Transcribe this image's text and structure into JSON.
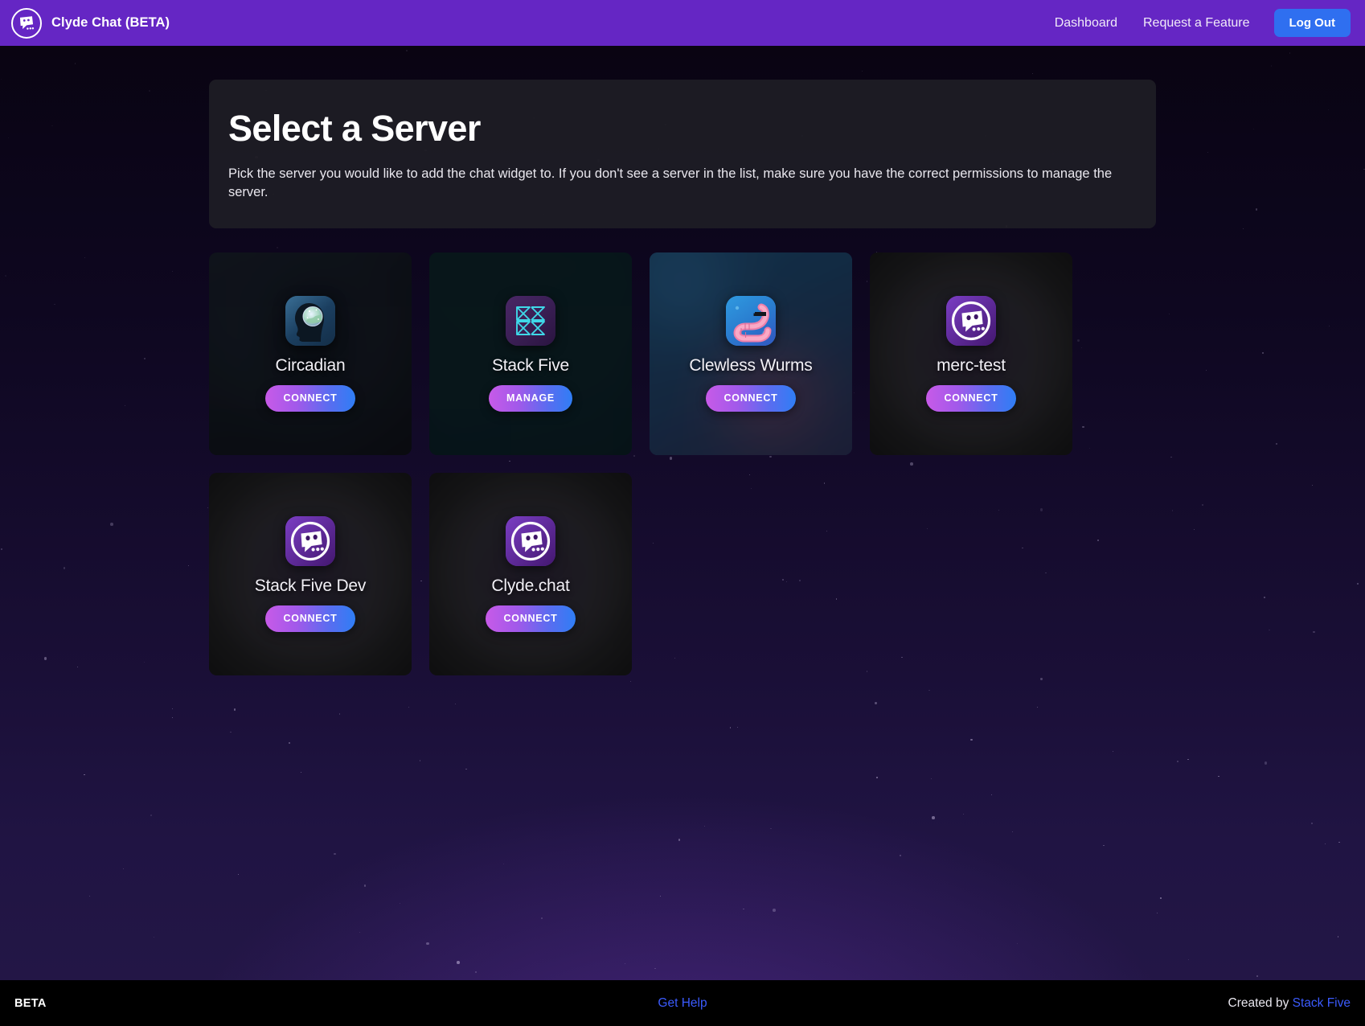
{
  "navbar": {
    "brand_label": "Clyde Chat (BETA)",
    "brand_icon": "clyde-chat-logo",
    "links": [
      {
        "label": "Dashboard",
        "name": "dashboard"
      },
      {
        "label": "Request a Feature",
        "name": "request-a-feature"
      }
    ],
    "logout_label": "Log Out",
    "bg_color": "#6526C4",
    "logout_color": "#2F6FF0"
  },
  "header": {
    "title": "Select a Server",
    "subtitle": "Pick the server you would like to add the chat widget to. If you don't see a server in the list, make sure you have the correct permissions to manage the server."
  },
  "servers": [
    {
      "name": "Circadian",
      "button_label": "CONNECT",
      "icon_type": "circadian-head-moon",
      "icon_bg": "#1e4668",
      "card_bg": "#101318"
    },
    {
      "name": "Stack Five",
      "button_label": "MANAGE",
      "icon_type": "stack-five-geometric",
      "icon_bg": "#3a1d52",
      "card_bg": "#0c1f22"
    },
    {
      "name": "Clewless Wurms",
      "button_label": "CONNECT",
      "icon_type": "clewless-wurm",
      "icon_bg": "#2b8cd6",
      "card_bg": "#1b3750"
    },
    {
      "name": "merc-test",
      "button_label": "CONNECT",
      "icon_type": "clyde-default",
      "icon_bg": "#5b2a9e",
      "card_bg": "#151515"
    },
    {
      "name": "Stack Five Dev",
      "button_label": "CONNECT",
      "icon_type": "clyde-default",
      "icon_bg": "#5b2a9e",
      "card_bg": "#151515"
    },
    {
      "name": "Clyde.chat",
      "button_label": "CONNECT",
      "icon_type": "clyde-default",
      "icon_bg": "#5b2a9e",
      "card_bg": "#151515"
    }
  ],
  "footer": {
    "beta_label": "BETA",
    "help_label": "Get Help",
    "credit_prefix": "Created by ",
    "credit_link": "Stack Five",
    "link_color": "#3B5BFD"
  }
}
